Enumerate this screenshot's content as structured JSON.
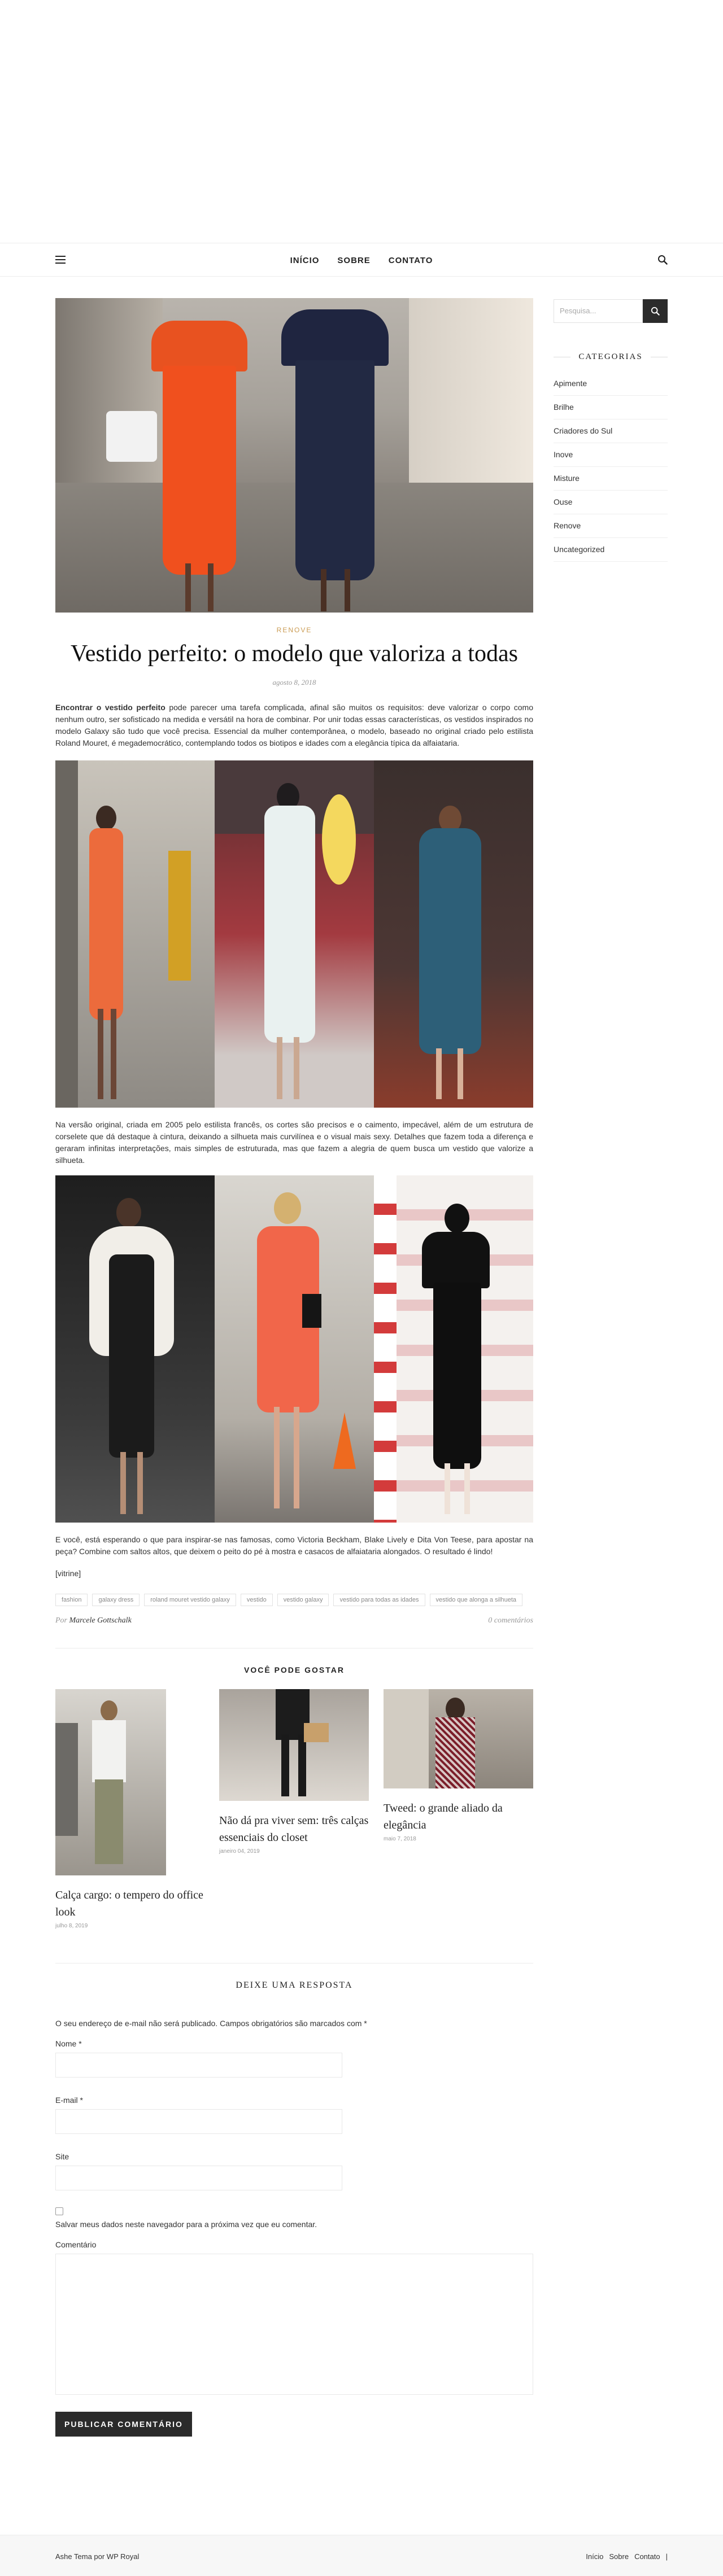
{
  "nav": {
    "menu_icon": "hamburger-icon",
    "items": [
      "INÍCIO",
      "SOBRE",
      "CONTATO"
    ],
    "search_icon": "search-icon"
  },
  "post": {
    "category": "RENOVE",
    "title": "Vestido perfeito: o modelo que valoriza a todas",
    "date": "agosto 8, 2018",
    "intro_bold": "Encontrar o vestido perfeito",
    "intro_rest": " pode parecer uma tarefa complicada, afinal são muitos os requisitos: deve valorizar o corpo como nenhum outro, ser sofisticado na medida e versátil na hora de combinar. Por unir todas essas características, os vestidos inspirados no modelo Galaxy são tudo que você precisa. Essencial da mulher contemporânea, o modelo, baseado no original criado pelo estilista Roland Mouret, é megademocrático, contemplando todos os biotipos e idades com a elegância típica da alfaiataria.",
    "para2": "Na versão original, criada em 2005 pelo estilista francês, os cortes são precisos e o caimento, impecável, além de um estrutura de corselete que dá destaque à cintura, deixando a silhueta mais curvilínea e o visual mais sexy. Detalhes que fazem toda a diferença e geraram infinitas interpretações, mais simples de estruturada, mas que fazem a alegria de quem busca um vestido que valorize a silhueta.",
    "para3": "E você, está esperando o que para inspirar-se nas famosas, como Victoria Beckham, Blake Lively e Dita Von Teese, para apostar na peça? Combine com saltos altos, que deixem o peito do pé à mostra e casacos de alfaiataria alongados. O resultado é lindo!",
    "shortcode": "[vitrine]",
    "tags": [
      "fashion",
      "galaxy dress",
      "roland mouret vestido galaxy",
      "vestido",
      "vestido galaxy",
      "vestido para todas as idades",
      "vestido que alonga a silhueta"
    ],
    "author_prefix": "Por",
    "author": "Marcele Gottschalk",
    "comments": "0 comentários"
  },
  "related": {
    "heading": "VOCÊ PODE GOSTAR",
    "items": [
      {
        "title": "Calça cargo: o tempero do office look",
        "date": "julho 8, 2019"
      },
      {
        "title": "Não dá pra viver sem: três calças essenciais do closet",
        "date": "janeiro 04, 2019"
      },
      {
        "title": "Tweed: o grande aliado da elegância",
        "date": "maio 7, 2018"
      }
    ]
  },
  "reply": {
    "heading": "DEIXE UMA RESPOSTA",
    "note": "O seu endereço de e-mail não será publicado. Campos obrigatórios são marcados com *",
    "name_label": "Nome *",
    "email_label": "E-mail *",
    "site_label": "Site",
    "save_label": "Salvar meus dados neste navegador para a próxima vez que eu comentar.",
    "comment_label": "Comentário",
    "submit": "PUBLICAR COMENTÁRIO"
  },
  "sidebar": {
    "search_placeholder": "Pesquisa...",
    "categories_heading": "CATEGORIAS",
    "categories": [
      "Apimente",
      "Brilhe",
      "Criadores do Sul",
      "Inove",
      "Misture",
      "Ouse",
      "Renove",
      "Uncategorized"
    ]
  },
  "footer": {
    "copy": "Ashe Tema por WP Royal",
    "links": [
      "Início",
      "Sobre",
      "Contato",
      "|"
    ]
  }
}
